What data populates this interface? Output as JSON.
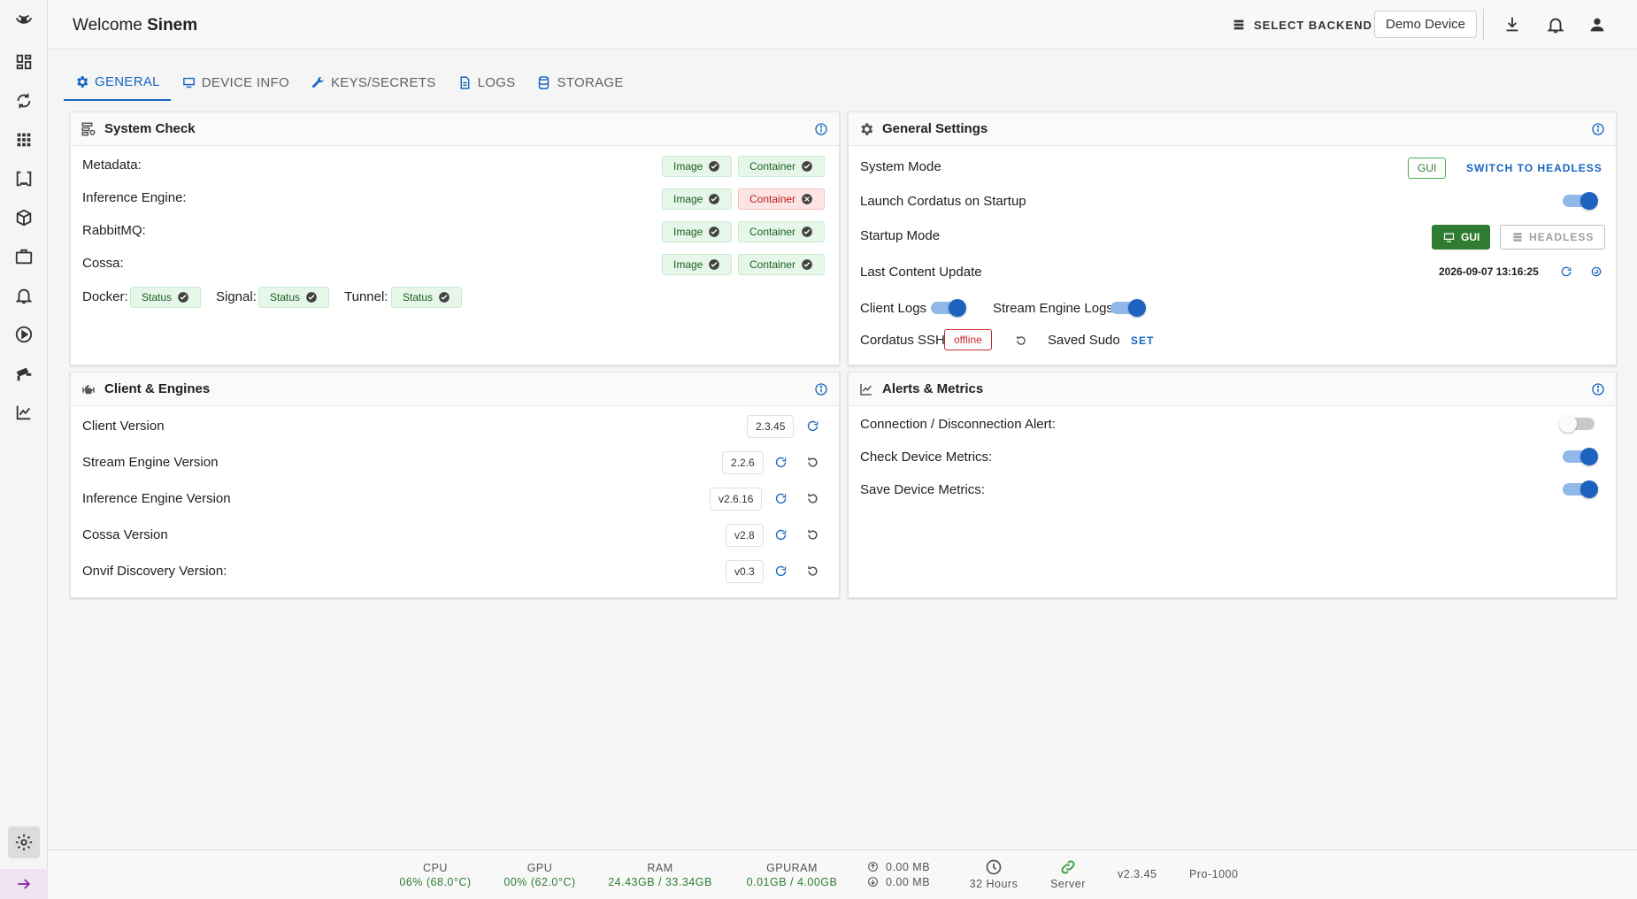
{
  "header": {
    "welcome_prefix": "Welcome",
    "user_name": "Sinem",
    "select_backend": "SELECT BACKEND",
    "device": "Demo Device"
  },
  "sidebar": {
    "items": [
      "logo-icon",
      "dashboard-icon",
      "sync-icon",
      "apps-icon",
      "scan-icon",
      "cube-icon",
      "briefcase-icon",
      "bell-icon",
      "play-icon",
      "camera-icon",
      "chart-icon"
    ],
    "settings": "gear-icon",
    "expand": "arrow-right-icon"
  },
  "tabs": [
    {
      "label": "GENERAL",
      "icon": "gear-icon"
    },
    {
      "label": "DEVICE INFO",
      "icon": "monitor-icon"
    },
    {
      "label": "KEYS/SECRETS",
      "icon": "wrench-icon"
    },
    {
      "label": "LOGS",
      "icon": "document-icon"
    },
    {
      "label": "STORAGE",
      "icon": "database-icon"
    }
  ],
  "system_check": {
    "title": "System Check",
    "rows": [
      {
        "label": "Metadata:",
        "image": "Image",
        "container": "Container",
        "container_ok": true
      },
      {
        "label": "Inference Engine:",
        "image": "Image",
        "container": "Container",
        "container_ok": false
      },
      {
        "label": "RabbitMQ:",
        "image": "Image",
        "container": "Container",
        "container_ok": true
      },
      {
        "label": "Cossa:",
        "image": "Image",
        "container": "Container",
        "container_ok": true
      }
    ],
    "services": [
      {
        "label": "Docker:",
        "status": "Status"
      },
      {
        "label": "Signal:",
        "status": "Status"
      },
      {
        "label": "Tunnel:",
        "status": "Status"
      }
    ]
  },
  "general_settings": {
    "title": "General Settings",
    "system_mode_label": "System Mode",
    "system_mode_value": "GUI",
    "switch_label": "SWITCH TO HEADLESS",
    "launch_label": "Launch Cordatus on Startup",
    "launch_on": true,
    "startup_mode_label": "Startup Mode",
    "startup_gui": "GUI",
    "startup_headless": "HEADLESS",
    "last_update_label": "Last Content Update",
    "last_update_value": "2026-09-07 13:16:25",
    "client_logs_label": "Client Logs",
    "client_logs_on": true,
    "stream_logs_label": "Stream Engine Logs",
    "stream_logs_on": true,
    "ssh_label": "Cordatus SSH",
    "ssh_status": "offline",
    "sudo_label": "Saved Sudo",
    "sudo_action": "SET"
  },
  "client_engines": {
    "title": "Client & Engines",
    "rows": [
      {
        "label": "Client Version",
        "version": "2.3.45"
      },
      {
        "label": "Stream Engine Version",
        "version": "2.2.6"
      },
      {
        "label": "Inference Engine Version",
        "version": "v2.6.16"
      },
      {
        "label": "Cossa Version",
        "version": "v2.8"
      },
      {
        "label": "Onvif Discovery Version:",
        "version": "v0.3"
      }
    ]
  },
  "alerts_metrics": {
    "title": "Alerts & Metrics",
    "rows": [
      {
        "label": "Connection / Disconnection Alert:",
        "on": false
      },
      {
        "label": "Check Device Metrics:",
        "on": true
      },
      {
        "label": "Save Device Metrics:",
        "on": true
      }
    ]
  },
  "footer": {
    "cpu_label": "CPU",
    "cpu_value": "06% (68.0°C)",
    "gpu_label": "GPU",
    "gpu_value": "00% (62.0°C)",
    "ram_label": "RAM",
    "ram_value": "24.43GB / 33.34GB",
    "gpuram_label": "GPURAM",
    "gpuram_value": "0.01GB / 4.00GB",
    "upload": "0.00 MB",
    "download": "0.00 MB",
    "uptime": "32 Hours",
    "server": "Server",
    "version": "v2.3.45",
    "model": "Pro-1000"
  },
  "colors": {
    "primary": "#1565c0",
    "success": "#2e7d32",
    "error": "#c62828"
  }
}
